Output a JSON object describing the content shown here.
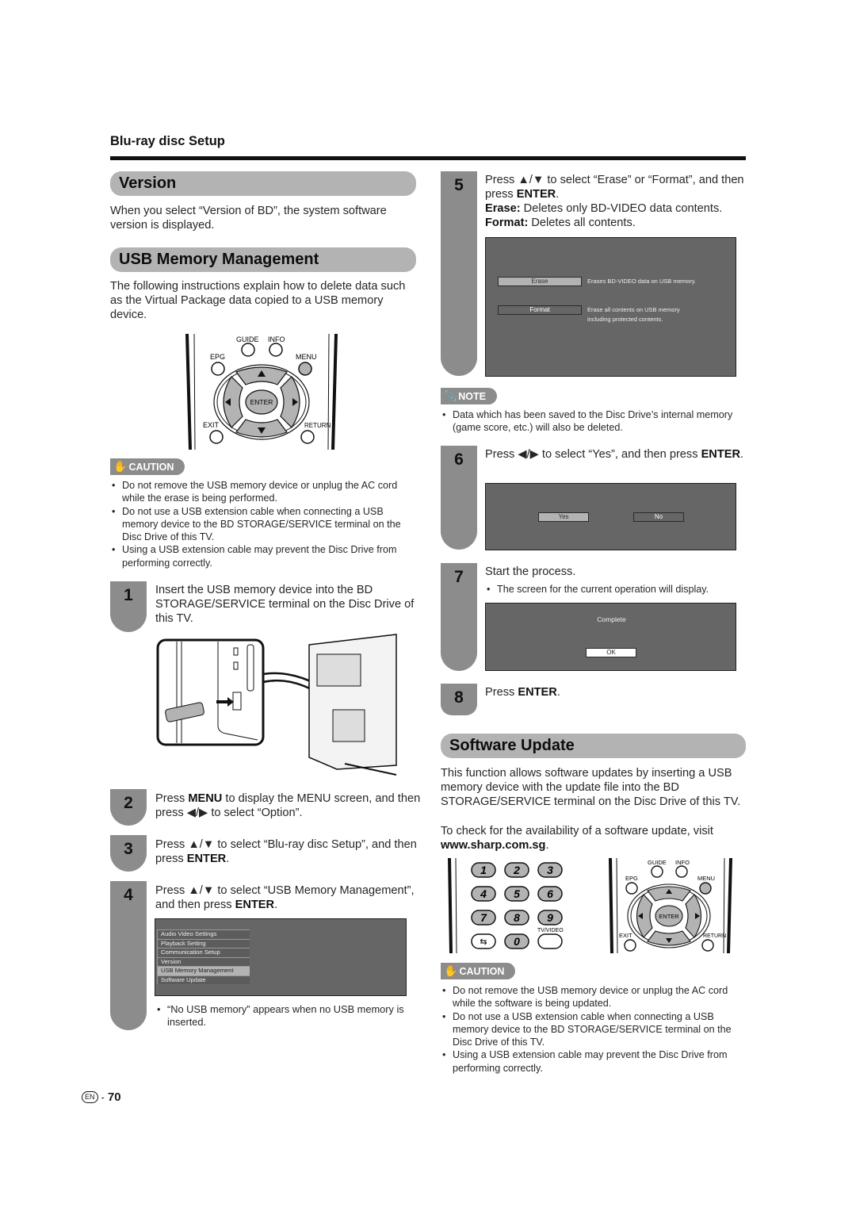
{
  "section_label": "Blu-ray disc Setup",
  "version": {
    "heading": "Version",
    "body": "When you select “Version of BD”, the system software version is displayed."
  },
  "usb_mgmt": {
    "heading": "USB Memory Management",
    "body": "The following instructions explain how to delete data such as the Virtual Package data copied to a USB memory device.",
    "remote": {
      "guide": "GUIDE",
      "info": "INFO",
      "epg": "EPG",
      "menu": "MENU",
      "enter": "ENTER",
      "exit": "EXIT",
      "return": "RETURN"
    },
    "caution_label": "CAUTION",
    "cautions": [
      "Do not remove the USB memory device or unplug the AC cord while the erase is being performed.",
      "Do not use a USB extension cable when connecting a USB memory device to the BD STORAGE/SERVICE terminal on the Disc Drive of this TV.",
      "Using a USB extension cable may prevent the Disc Drive from performing correctly."
    ]
  },
  "steps": {
    "s1": {
      "num": "1",
      "text": "Insert the USB memory device into the BD STORAGE/SERVICE terminal on the Disc Drive of this TV."
    },
    "s2": {
      "num": "2",
      "pre": "Press ",
      "bold": "MENU",
      "mid": " to display the MENU screen, and then press ",
      "arrows": "◀/▶",
      "post": " to select “Option”."
    },
    "s3": {
      "num": "3",
      "pre": "Press ",
      "arrows": "▲/▼",
      "mid": " to select “Blu-ray disc Setup”, and then press ",
      "bold": "ENTER",
      "post": "."
    },
    "s4": {
      "num": "4",
      "pre": "Press ",
      "arrows": "▲/▼",
      "mid": " to select “USB Memory Management”, and then press ",
      "bold": "ENTER",
      "post": ".",
      "menu": [
        "Audio Video Settings",
        "Playback Setting",
        "Communication Setup",
        "Version",
        "USB Memory Management",
        "Software Update"
      ],
      "menu_selected": "USB Memory Management",
      "note": "“No USB memory” appears when no USB memory is inserted."
    },
    "s5": {
      "num": "5",
      "pre": "Press ",
      "arrows": "▲/▼",
      "mid": " to select “Erase” or “Format”, and then press ",
      "bold": "ENTER",
      "post": ".",
      "erase_label": "Erase:",
      "erase_desc": " Deletes only BD-VIDEO data contents.",
      "format_label": "Format:",
      "format_desc": " Deletes all contents.",
      "osd": {
        "erase_btn": "Erase",
        "erase_info": "Erases BD-VIDEO data on USB memory.",
        "format_btn": "Format",
        "format_info_1": "Erase all contents on USB memory",
        "format_info_2": "including protected contents."
      }
    },
    "note_label": "NOTE",
    "note": "Data which has been saved to the Disc Drive’s internal memory (game score, etc.) will also be deleted.",
    "s6": {
      "num": "6",
      "pre": "Press ",
      "arrows": "◀/▶",
      "mid": " to select “Yes”, and then press ",
      "bold": "ENTER",
      "post": ".",
      "osd": {
        "yes": "Yes",
        "no": "No"
      }
    },
    "s7": {
      "num": "7",
      "text": "Start the process.",
      "bullet": "The screen for the current operation will display.",
      "osd": {
        "status": "Complete",
        "ok": "OK"
      }
    },
    "s8": {
      "num": "8",
      "pre": "Press ",
      "bold": "ENTER",
      "post": "."
    }
  },
  "software_update": {
    "heading": "Software Update",
    "body": "This function allows software updates by inserting a USB memory device with the update file into the BD STORAGE/SERVICE terminal on the Disc Drive of this TV.",
    "check_pre": "To check for the availability of a software update, visit ",
    "url": "www.sharp.com.sg",
    "check_post": ".",
    "keypad": [
      "1",
      "2",
      "3",
      "4",
      "5",
      "6",
      "7",
      "8",
      "9",
      "0"
    ],
    "tv_video": "TV/VIDEO",
    "caution_label": "CAUTION",
    "cautions": [
      "Do not remove the USB memory device or unplug the AC cord while the software is being updated.",
      "Do not use a USB extension cable when connecting a USB memory device to the BD STORAGE/SERVICE terminal on the Disc Drive of this TV.",
      "Using a USB extension cable may prevent the Disc Drive from performing correctly."
    ]
  },
  "footer": {
    "lang": "EN",
    "sep": "-",
    "page": "70"
  }
}
